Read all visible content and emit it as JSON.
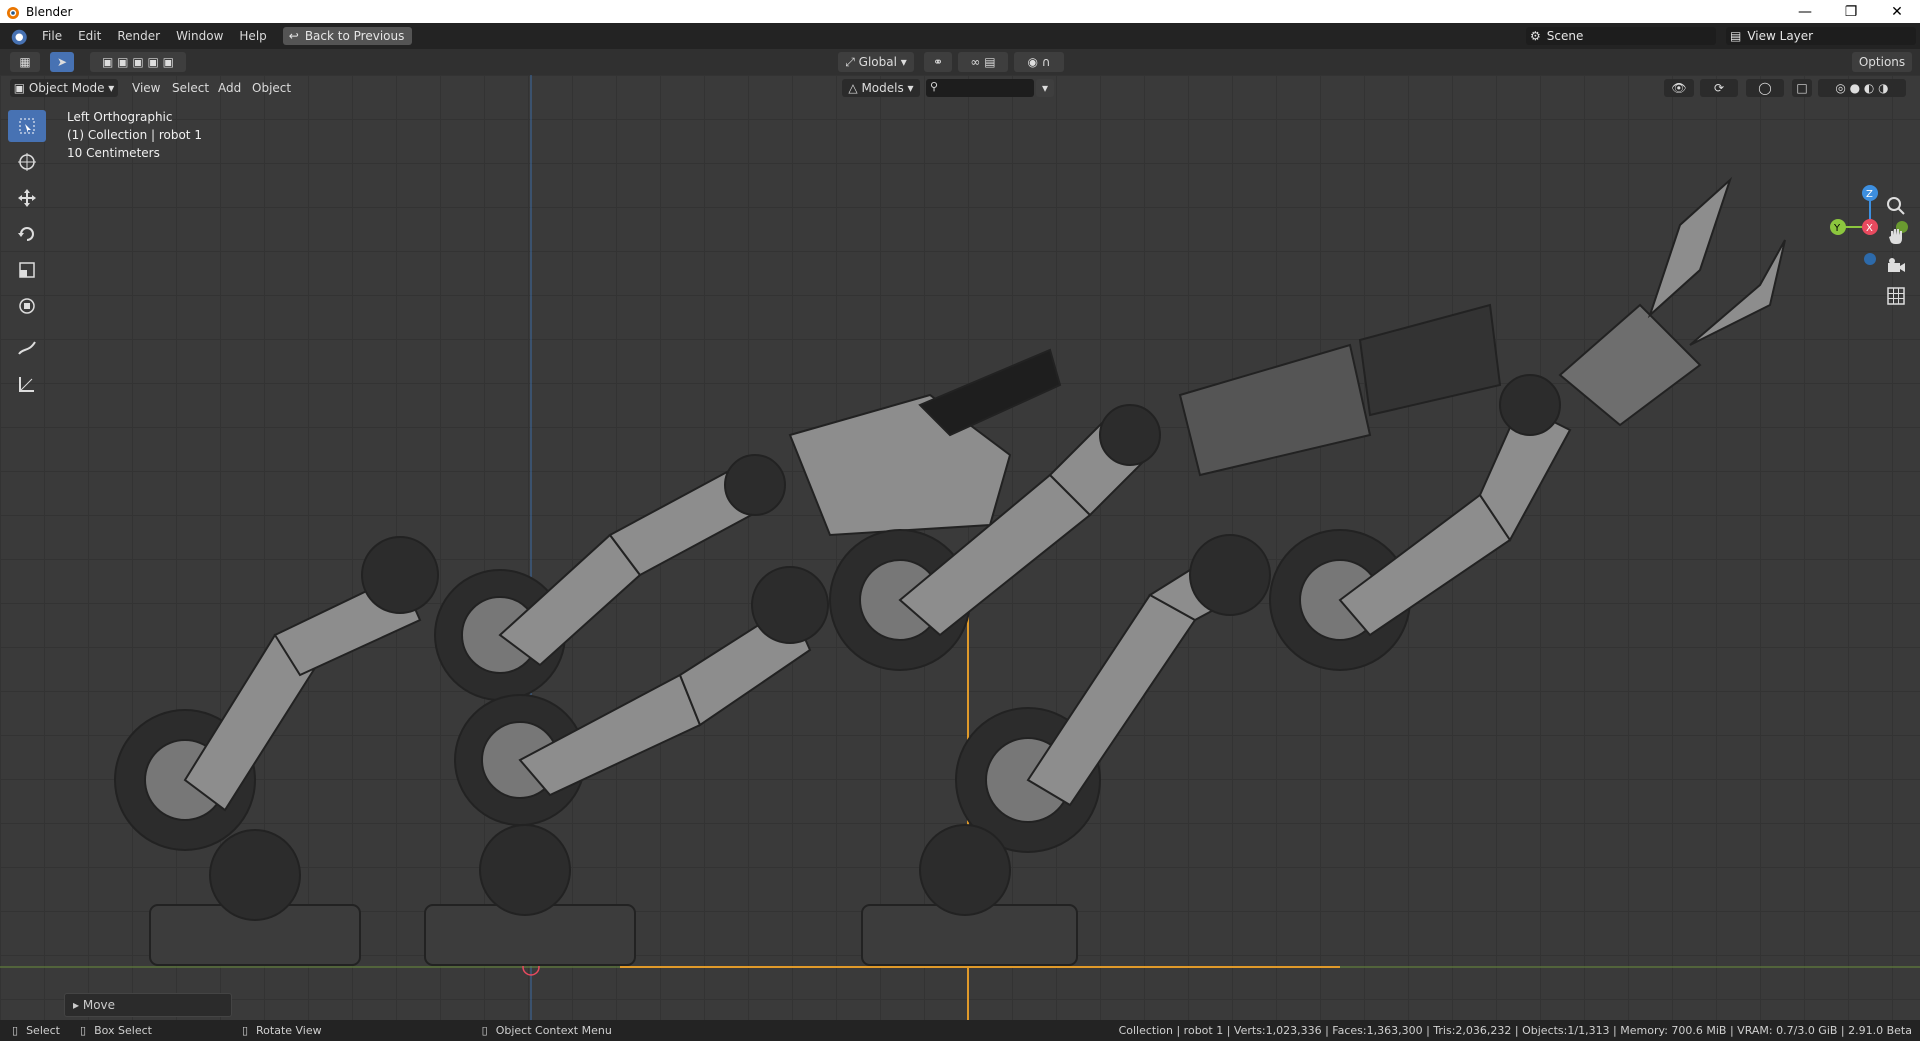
{
  "window": {
    "title": "Blender"
  },
  "menu": {
    "file": "File",
    "edit": "Edit",
    "render": "Render",
    "window": "Window",
    "help": "Help",
    "back": "Back to Previous"
  },
  "scene": {
    "name": "Scene",
    "view_layer": "View Layer"
  },
  "header": {
    "transform_orientation": "Global",
    "options": "Options",
    "models": "Models"
  },
  "viewport_menu": {
    "mode": "Object Mode",
    "view": "View",
    "select": "Select",
    "add": "Add",
    "object": "Object"
  },
  "overlay": {
    "view_name": "Left Orthographic",
    "collection": "(1) Collection | robot 1",
    "scale": "10 Centimeters"
  },
  "last_op": {
    "label": "Move"
  },
  "status": {
    "select": "Select",
    "box_select": "Box Select",
    "rotate_view": "Rotate View",
    "context_menu": "Object Context Menu",
    "stats": "Collection | robot 1 | Verts:1,023,336 | Faces:1,363,300 | Tris:2,036,232 | Objects:1/1,313 | Memory: 700.6 MiB | VRAM: 0.7/3.0 GiB | 2.91.0 Beta"
  },
  "colors": {
    "accent": "#4772b3",
    "selection": "#f5a623",
    "axis_x": "#e84a5f",
    "axis_y": "#8cc63e",
    "axis_z": "#3d8fe0"
  },
  "icons": [
    "blender-logo-icon",
    "minimize-icon",
    "maximize-icon",
    "close-icon",
    "select-box-icon",
    "cursor-icon",
    "move-icon",
    "rotate-icon",
    "scale-icon",
    "transform-icon",
    "annotate-icon",
    "measure-icon",
    "zoom-icon",
    "pan-hand-icon",
    "camera-icon",
    "grid-icon"
  ]
}
